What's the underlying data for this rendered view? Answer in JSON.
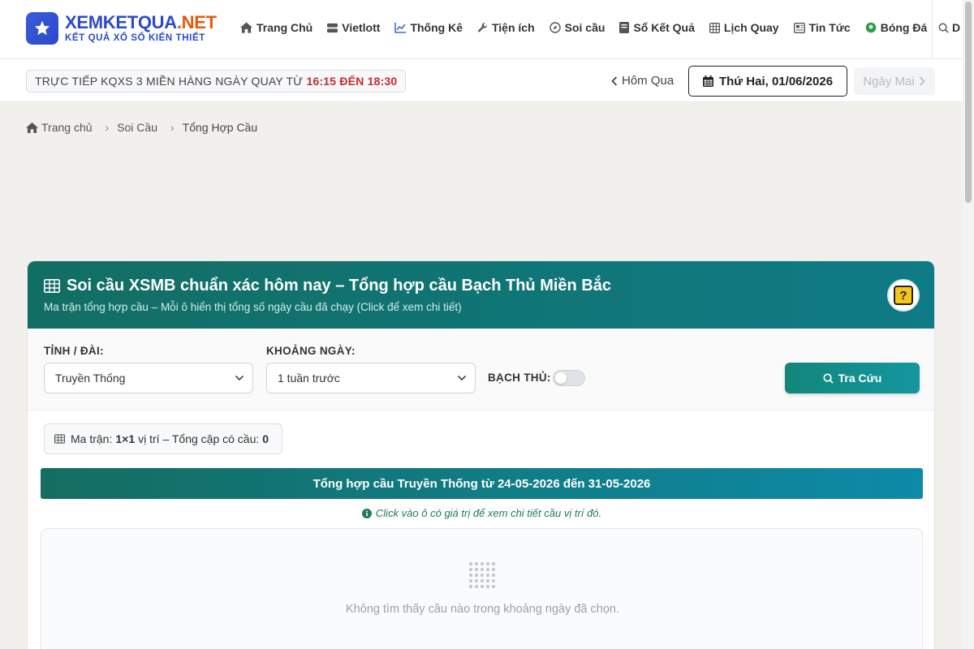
{
  "brand": {
    "name_part1": "XEMKETQUA",
    "name_part2": ".NET",
    "tagline": "KẾT QUẢ XỔ SỐ KIẾN THIẾT",
    "icon": "star-icon"
  },
  "nav": {
    "items": [
      {
        "label": "Trang Chủ",
        "icon": "home-icon"
      },
      {
        "label": "Vietlott",
        "icon": "database-icon"
      },
      {
        "label": "Thống Kê",
        "icon": "chart-line-icon"
      },
      {
        "label": "Tiện ích",
        "icon": "wrench-icon"
      },
      {
        "label": "Soi cầu",
        "icon": "compass-icon"
      },
      {
        "label": "Sổ Kết Quả",
        "icon": "book-icon"
      },
      {
        "label": "Lịch Quay",
        "icon": "calendar-grid-icon"
      },
      {
        "label": "Tin Tức",
        "icon": "newspaper-icon"
      },
      {
        "label": "Bóng Đá",
        "icon": "soccer-ball-icon"
      }
    ],
    "search_label": "D"
  },
  "subbar": {
    "live_prefix": "TRỰC TIẾP KQXS 3 MIỀN HÀNG NGÀY QUAY TỪ",
    "live_time": "16:15 ĐẾN 18:30",
    "prev_label": "Hôm Qua",
    "current_date": "Thứ Hai, 01/06/2026",
    "next_label": "Ngày Mai"
  },
  "breadcrumb": {
    "home": "Trang chủ",
    "level1": "Soi Cầu",
    "level2": "Tổng Hợp Cầu"
  },
  "card": {
    "title": "Soi cầu XSMB chuẩn xác hôm nay – Tổng hợp cầu Bạch Thủ Miền Bắc",
    "description": "Ma trận tổng hợp cầu – Mỗi ô hiển thị tổng số ngày cầu đã chạy (Click để xem chi tiết)",
    "help_glyph": "?",
    "filters": {
      "province_label": "TỈNH / ĐÀI:",
      "province_value": "Truyền Thống",
      "range_label": "KHOẢNG NGÀY:",
      "range_value": "1 tuần trước",
      "bachthu_label": "BẠCH THỦ:",
      "bachthu_on": false,
      "search_label": "Tra Cứu"
    },
    "matrix": {
      "prefix": "Ma trận:",
      "size": "1×1",
      "middle": "vị trí – Tổng cặp có cầu:",
      "total": "0"
    },
    "range_title": "Tổng hợp cầu Truyền Thống từ 24-05-2026 đến 31-05-2026",
    "hint": "Click vào ô có giá trị để xem chi tiết cầu vị trí đó.",
    "empty_text": "Không tìm thấy cầu nào trong khoảng ngày đã chọn."
  },
  "colors": {
    "brand_blue": "#2b4acb",
    "brand_orange": "#e8590c",
    "header_teal": "#126e63",
    "accent_teal": "#12867a",
    "live_red": "#c92a2a"
  }
}
